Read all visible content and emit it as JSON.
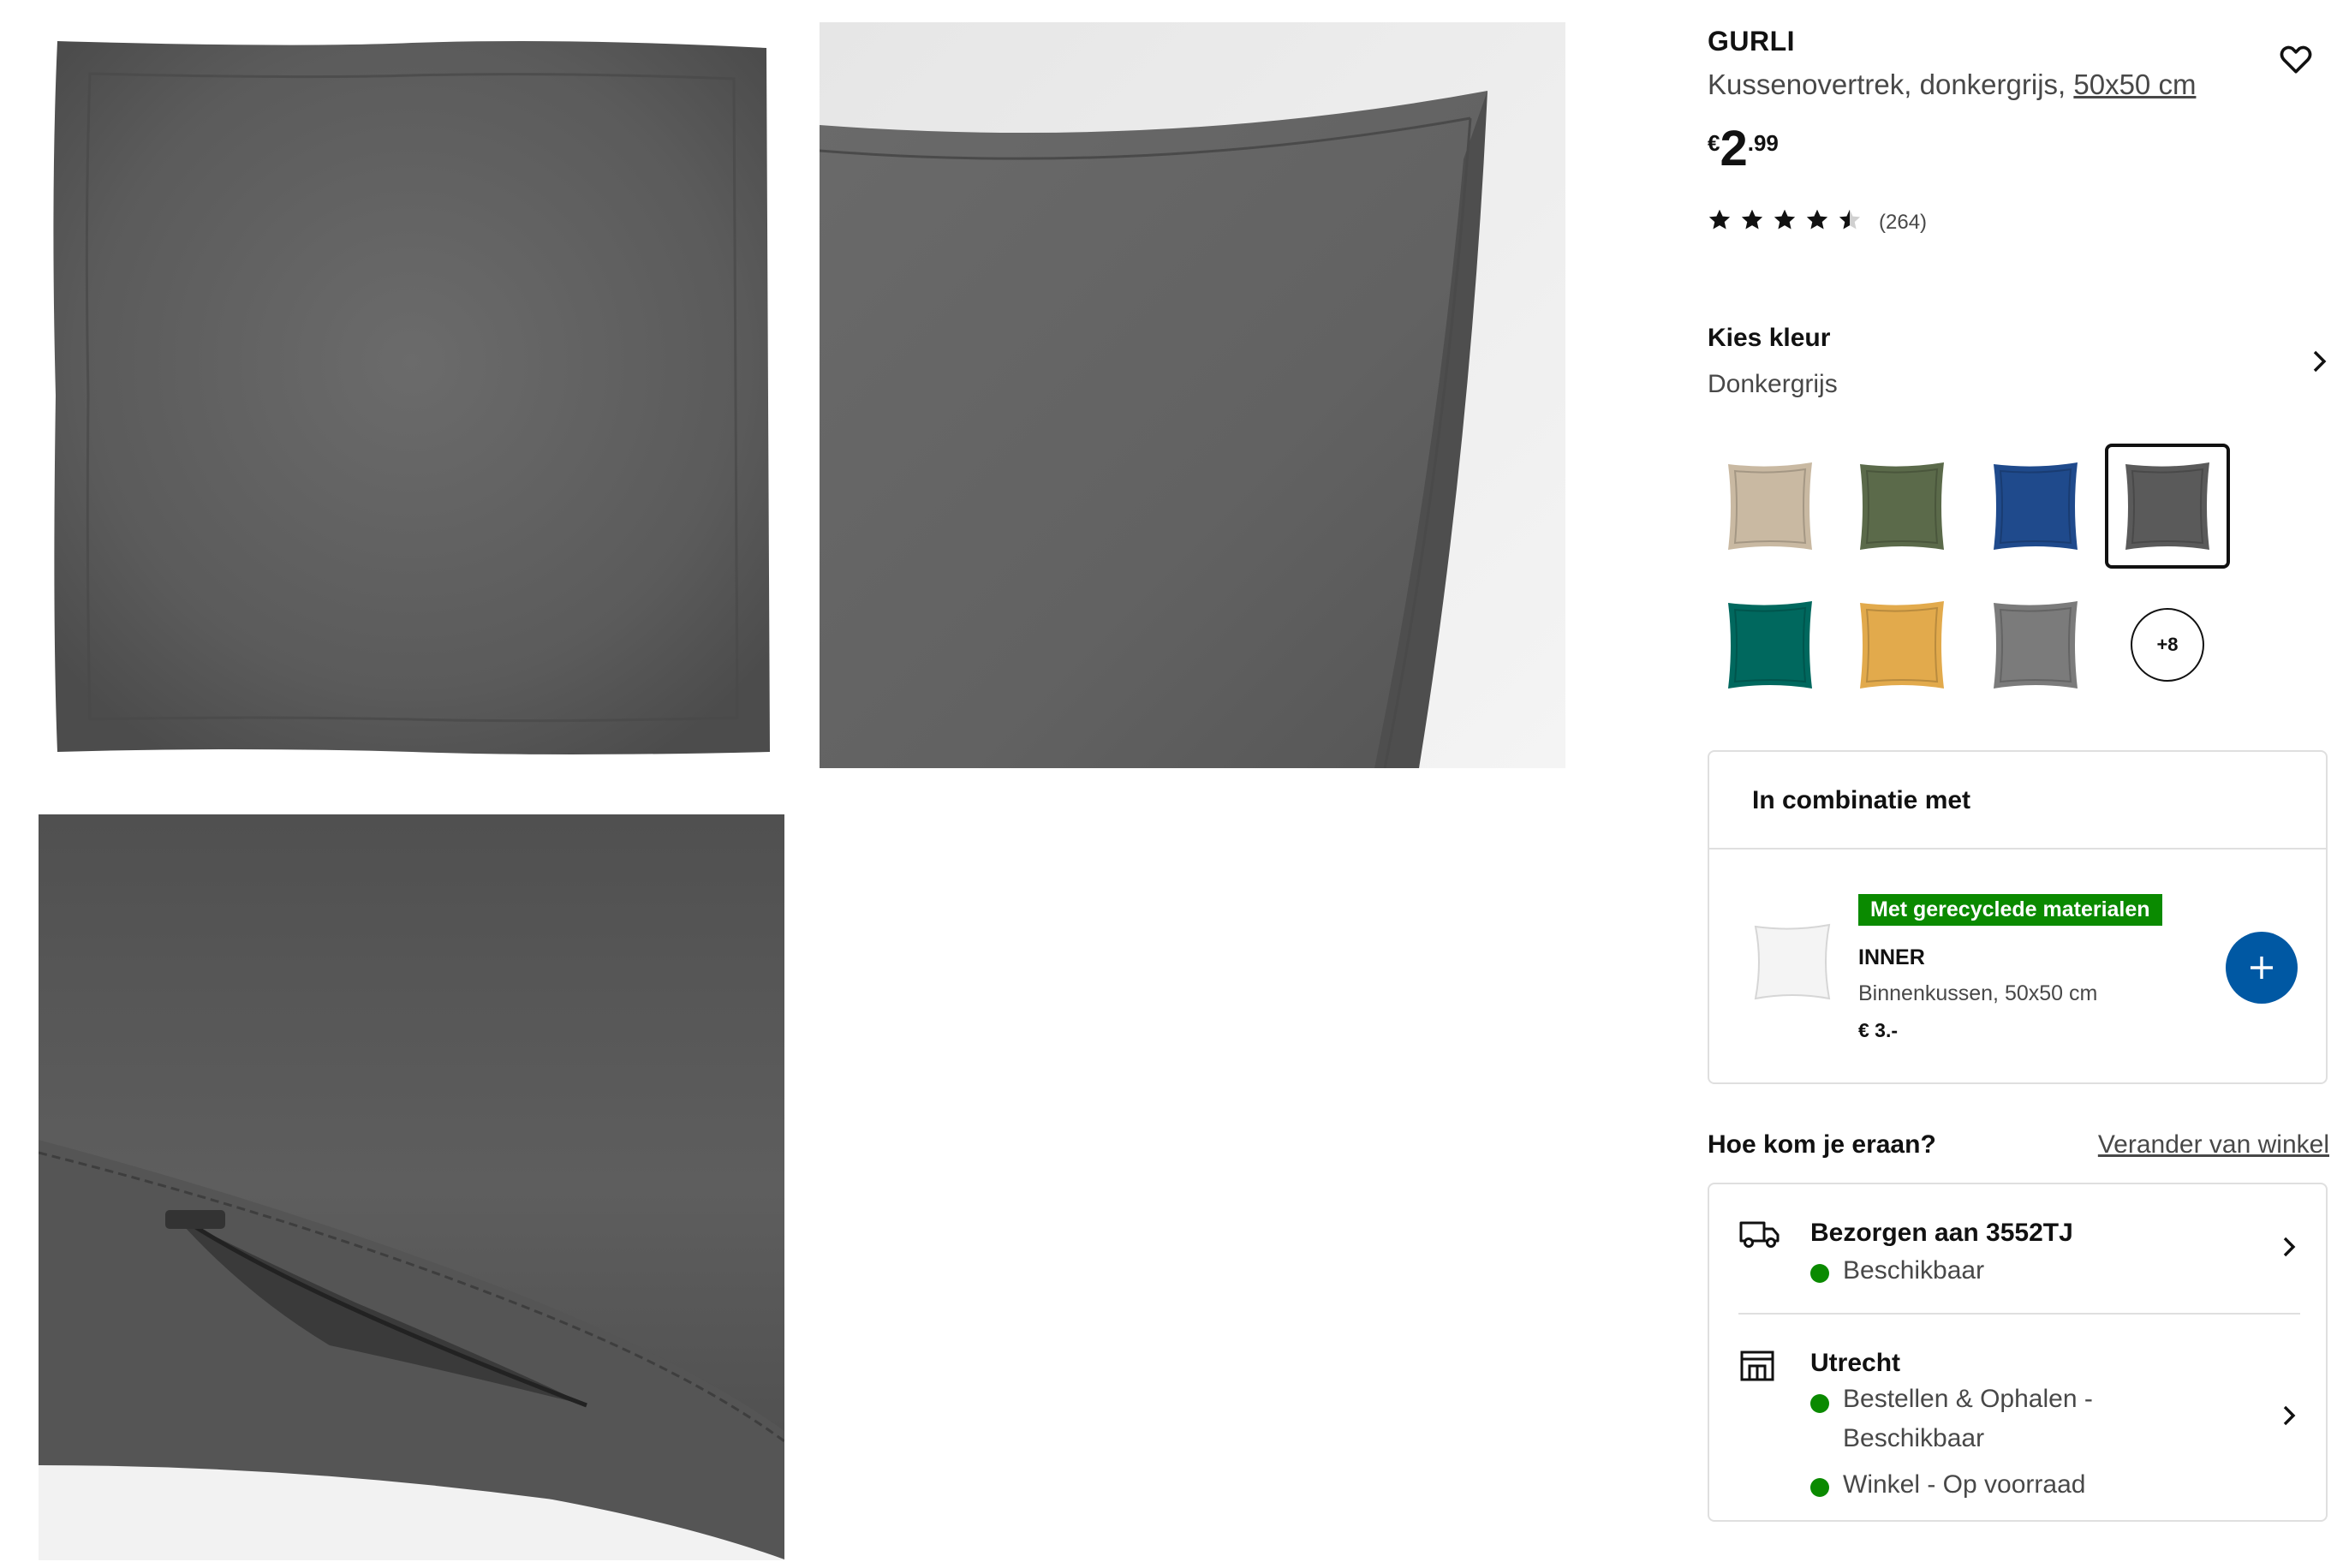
{
  "product": {
    "name": "GURLI",
    "description": "Kussenovertrek, donkergrijs,",
    "size_link": "50x50 cm",
    "price_currency": "€",
    "price_integer": "2",
    "price_decimal": ".99",
    "rating_value": 4.5,
    "rating_max": 5,
    "rating_count": "(264)"
  },
  "color_picker": {
    "label": "Kies kleur",
    "selected": "Donkergrijs",
    "swatches": [
      {
        "name": "beige",
        "color": "#c9b9a2"
      },
      {
        "name": "green",
        "color": "#5b6a4a"
      },
      {
        "name": "blue",
        "color": "#1f4a8c"
      },
      {
        "name": "dark-grey",
        "color": "#5a5a5a",
        "selected": true
      },
      {
        "name": "teal",
        "color": "#00685e"
      },
      {
        "name": "yellow",
        "color": "#e2aa4c"
      },
      {
        "name": "grey",
        "color": "#7b7b7b"
      }
    ],
    "more_label": "+8"
  },
  "combination": {
    "title": "In combinatie met",
    "badge": "Met gerecyclede materialen",
    "name": "INNER",
    "description": "Binnenkussen, 50x50 cm",
    "price": "€ 3.-"
  },
  "availability": {
    "title": "Hoe kom je eraan?",
    "change_store_link": "Verander van winkel",
    "delivery_title": "Bezorgen aan 3552TJ",
    "delivery_status": "Beschikbaar",
    "store_title": "Utrecht",
    "store_status_1": "Bestellen & Ophalen - Beschikbaar",
    "store_status_2": "Winkel - Op voorraad",
    "status_color": "#0a8a00"
  },
  "colors": {
    "accent_blue": "#0058a3",
    "badge_green": "#0a8a00",
    "pillow_grey": "#5f5f5f"
  }
}
